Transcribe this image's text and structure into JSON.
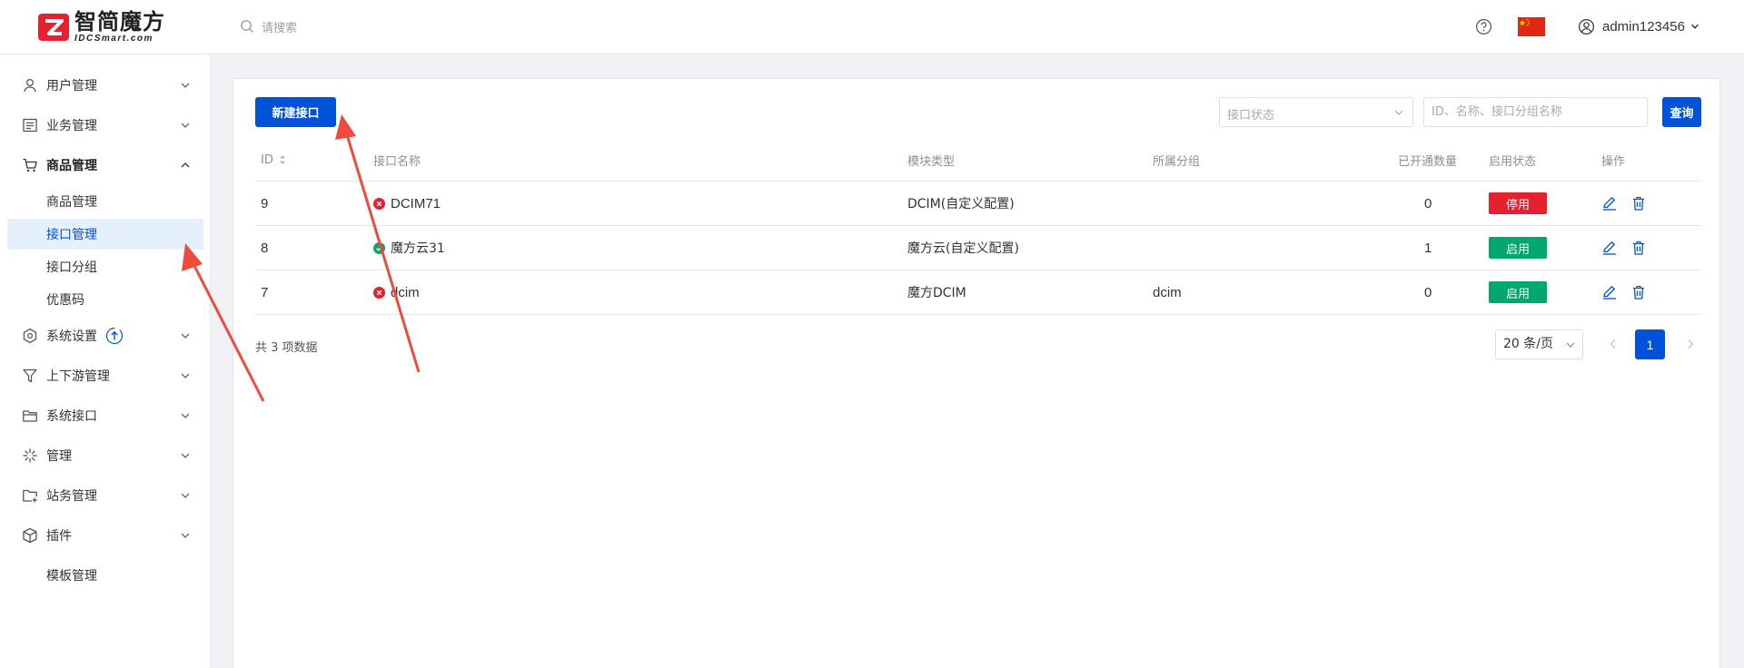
{
  "header": {
    "logo_cn": "智简魔方",
    "logo_en": "IDCSmart.com",
    "search_placeholder": "请搜索",
    "username": "admin123456"
  },
  "sidebar": {
    "items": [
      {
        "label": "用户管理",
        "icon": "user-icon"
      },
      {
        "label": "业务管理",
        "icon": "list-icon"
      },
      {
        "label": "商品管理",
        "icon": "cart-icon"
      },
      {
        "label": "系统设置",
        "icon": "settings-icon"
      },
      {
        "label": "上下游管理",
        "icon": "filter-icon"
      },
      {
        "label": "系统接口",
        "icon": "folder-icon"
      },
      {
        "label": "管理",
        "icon": "asterisk-icon"
      },
      {
        "label": "站务管理",
        "icon": "folder-add-icon"
      },
      {
        "label": "插件",
        "icon": "cube-icon"
      }
    ],
    "product_sub": [
      "商品管理",
      "接口管理",
      "接口分组",
      "优惠码"
    ],
    "plugin_sub": [
      "模板管理"
    ]
  },
  "toolbar": {
    "new_label": "新建接口",
    "status_placeholder": "接口状态",
    "search_placeholder": "ID、名称、接口分组名称",
    "query_label": "查询"
  },
  "table": {
    "headers": [
      "ID",
      "接口名称",
      "模块类型",
      "所属分组",
      "已开通数量",
      "启用状态",
      "操作"
    ],
    "rows": [
      {
        "id": "9",
        "name": "DCIM71",
        "online": false,
        "module": "DCIM(自定义配置)",
        "group": "",
        "count": "0",
        "status": "停用",
        "enabled": false
      },
      {
        "id": "8",
        "name": "魔方云31",
        "online": true,
        "module": "魔方云(自定义配置)",
        "group": "",
        "count": "1",
        "status": "启用",
        "enabled": true
      },
      {
        "id": "7",
        "name": "dcim",
        "online": false,
        "module": "魔方DCIM",
        "group": "dcim",
        "count": "0",
        "status": "启用",
        "enabled": true
      }
    ]
  },
  "pagination": {
    "total_text": "共 3 项数据",
    "page_size": "20 条/页",
    "current_page": "1"
  },
  "colors": {
    "primary": "#0052d9",
    "danger": "#e5202f",
    "success": "#00a870",
    "arrow": "#f04a3e"
  }
}
